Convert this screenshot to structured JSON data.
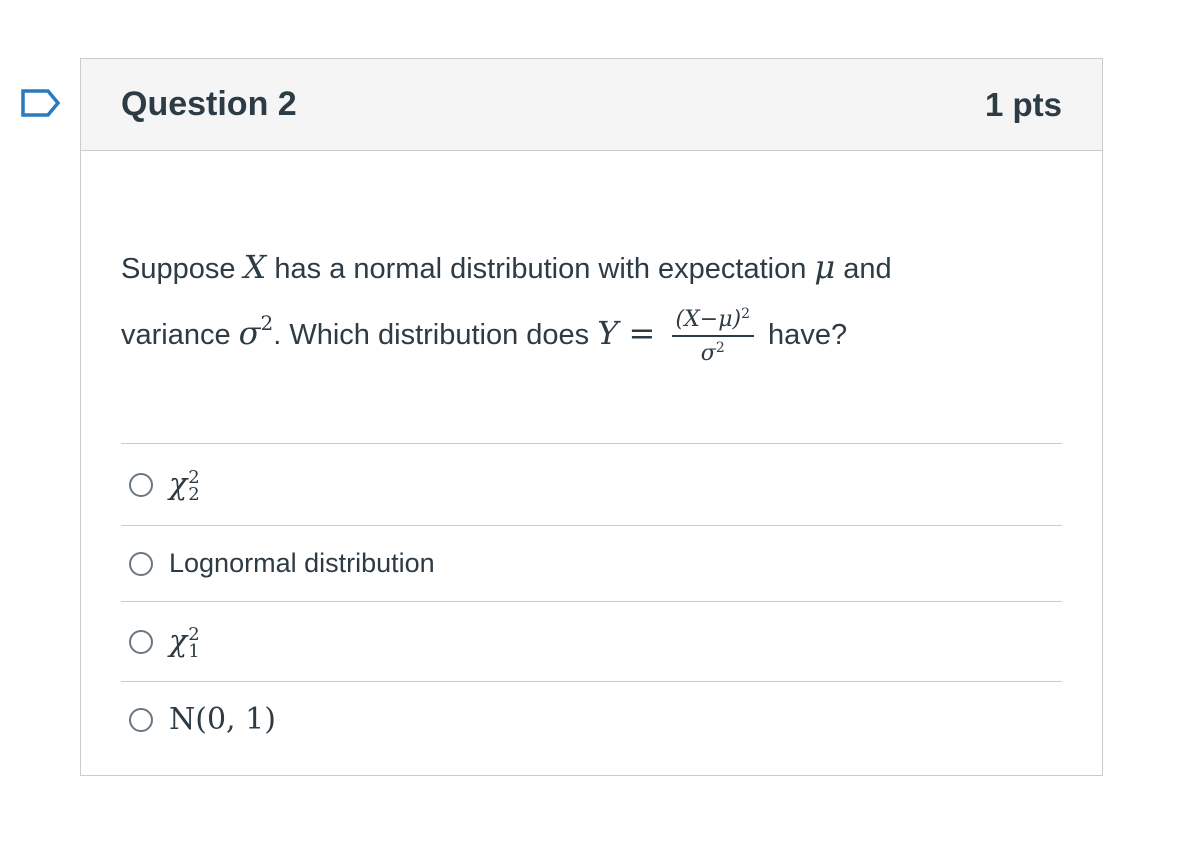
{
  "question": {
    "title": "Question 2",
    "points": "1 pts",
    "text_part1": "Suppose ",
    "var_x": "X",
    "text_part2": " has a normal distribution with expectation ",
    "var_mu": "μ",
    "text_part3": " and",
    "text_part4": "variance ",
    "var_sigma": "σ",
    "exp_2": "2",
    "text_part5": ". Which distribution does ",
    "var_y": "Y",
    "equals": " = ",
    "frac_num": "(X−μ)",
    "frac_num_exp": "2",
    "frac_den": "σ",
    "frac_den_exp": "2",
    "text_part6": " have?"
  },
  "answers": [
    {
      "type": "chi",
      "symbol": "χ",
      "sup": "2",
      "sub": "2"
    },
    {
      "type": "text",
      "label": "Lognormal distribution"
    },
    {
      "type": "chi",
      "symbol": "χ",
      "sup": "2",
      "sub": "1"
    },
    {
      "type": "normal",
      "label": "N(0, 1)"
    }
  ],
  "icons": {
    "flag": "bookmark-flag-icon",
    "radio": "radio-unchecked-icon"
  },
  "colors": {
    "text": "#2d3b45",
    "border": "#c7cdd1",
    "header_bg": "#f5f5f5",
    "flag": "#2b7abc"
  }
}
